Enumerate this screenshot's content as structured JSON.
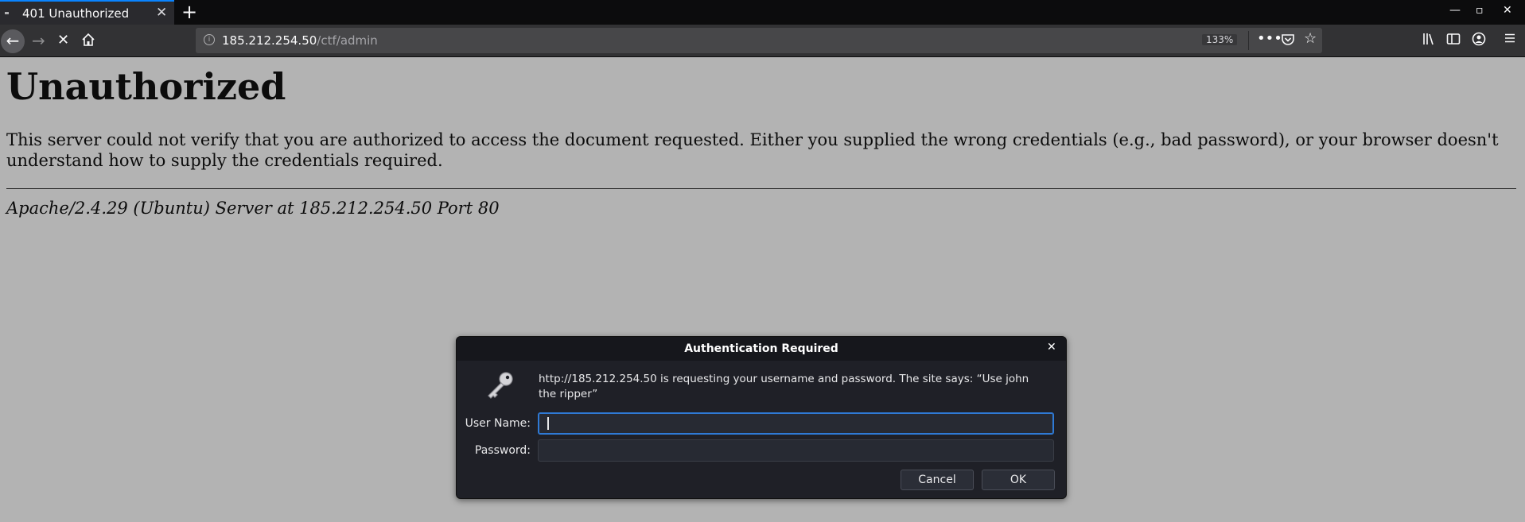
{
  "browser": {
    "tab": {
      "title": "401 Unauthorized"
    },
    "url": {
      "host": "185.212.254.50",
      "path": "/ctf/admin"
    },
    "zoom": "133%"
  },
  "page": {
    "heading": "Unauthorized",
    "message": "This server could not verify that you are authorized to access the document requested. Either you supplied the wrong credentials (e.g., bad password), or your browser doesn't understand how to supply the credentials required.",
    "address": "Apache/2.4.29 (Ubuntu) Server at 185.212.254.50 Port 80"
  },
  "dialog": {
    "title": "Authentication Required",
    "message": "http://185.212.254.50 is requesting your username and password. The site says: “Use john the ripper”",
    "username_label": "User Name:",
    "username_value": "",
    "password_label": "Password:",
    "password_value": "",
    "cancel_label": "Cancel",
    "ok_label": "OK"
  },
  "icons": {
    "back": "back-arrow-icon",
    "forward": "forward-arrow-icon",
    "stop": "stop-icon",
    "home": "home-icon",
    "info": "info-icon",
    "more": "more-actions-icon",
    "pocket": "pocket-icon",
    "bookmark": "bookmark-star-icon",
    "library": "library-icon",
    "sidebar": "sidebar-icon",
    "account": "account-icon",
    "menu": "hamburger-menu-icon",
    "key": "key-icon"
  },
  "colors": {
    "accent": "#0a84ff",
    "page_background": "#b3b3b3",
    "dialog_background": "#1f2027"
  }
}
